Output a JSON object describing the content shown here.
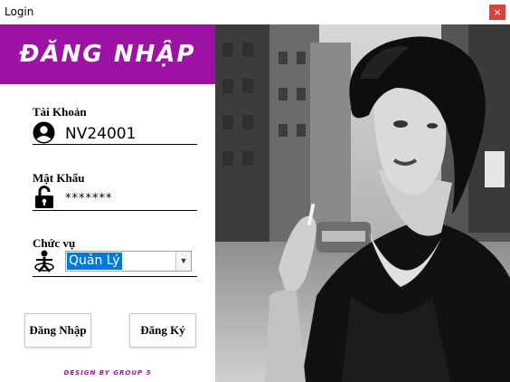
{
  "window": {
    "title": "Login",
    "close_glyph": "×"
  },
  "header": {
    "title": "ĐĂNG NHẬP",
    "color": "#9b12a4"
  },
  "form": {
    "account": {
      "label": "Tài Khoản",
      "value": "NV24001",
      "icon": "user-circle-icon"
    },
    "password": {
      "label": "Mật Khẩu",
      "value": "*******",
      "icon": "unlocked-padlock-icon"
    },
    "role": {
      "label": "Chức vụ",
      "selected": "Quản Lý",
      "icon": "person-icon"
    }
  },
  "buttons": {
    "login": "Đăng Nhập",
    "register": "Đăng Ký"
  },
  "footer": {
    "text": "DESIGN BY GROUP 5"
  },
  "photo": {
    "description_icon": "portrait-photo"
  }
}
